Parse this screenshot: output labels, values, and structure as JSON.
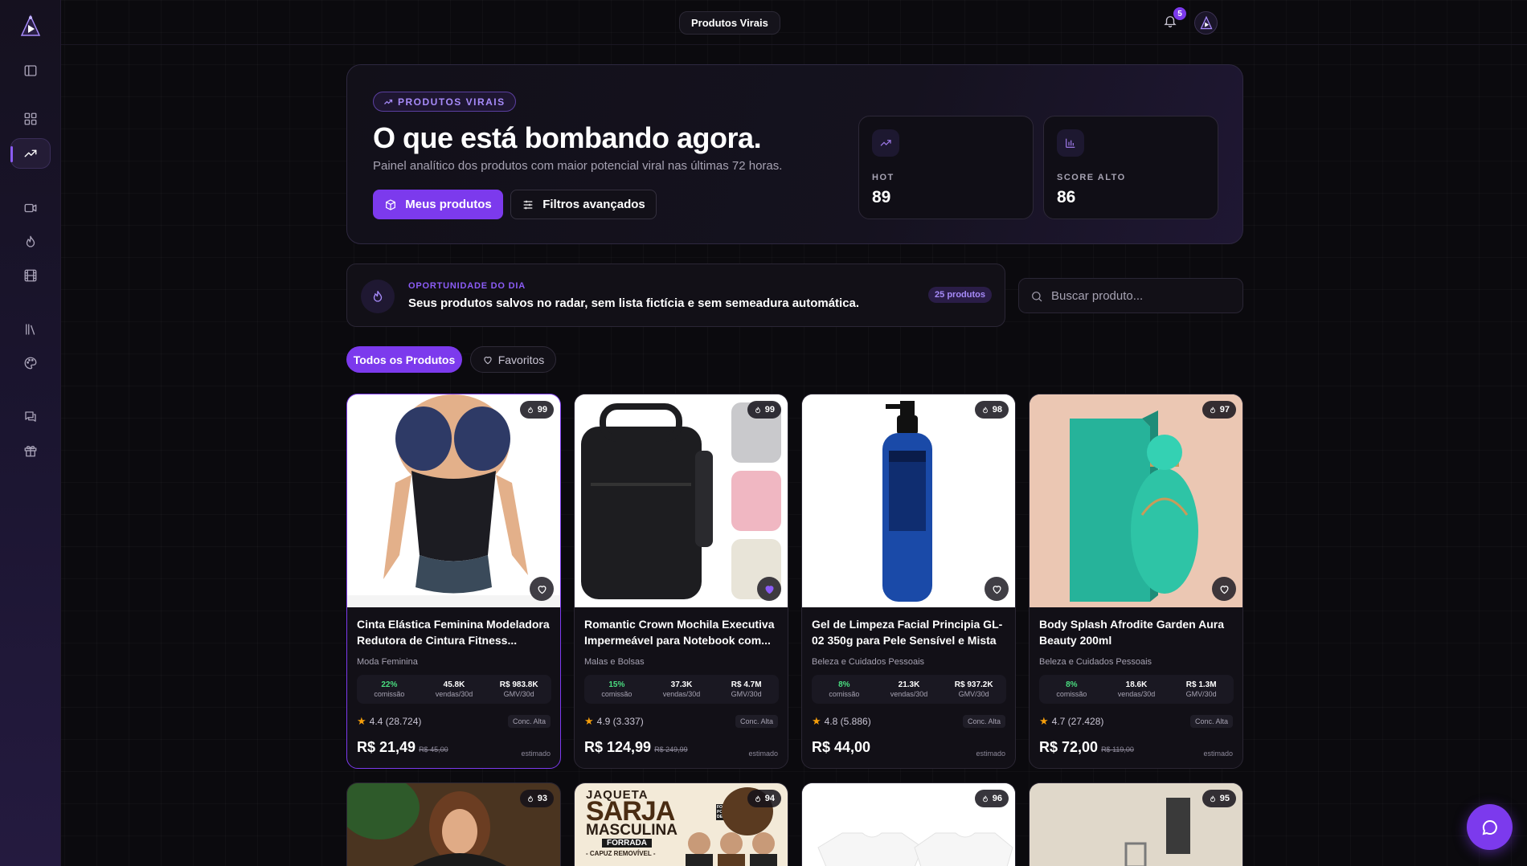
{
  "header": {
    "title": "Produtos Virais",
    "notifications": "5"
  },
  "hero": {
    "pill": "PRODUTOS VIRAIS",
    "title": "O que está bombando agora.",
    "subtitle": "Painel analítico dos produtos com maior potencial viral nas últimas 72 horas.",
    "primary_button": "Meus produtos",
    "secondary_button": "Filtros avançados",
    "stats": [
      {
        "label": "HOT",
        "value": "89",
        "icon": "trending-up-icon"
      },
      {
        "label": "SCORE ALTO",
        "value": "86",
        "icon": "bar-chart-icon"
      }
    ]
  },
  "opportunity": {
    "kicker": "OPORTUNIDADE DO DIA",
    "text": "Seus produtos salvos no radar, sem lista fictícia e sem semeadura automática.",
    "count": "25 produtos"
  },
  "search": {
    "placeholder": "Buscar produto..."
  },
  "filters": {
    "all": "Todos os Produtos",
    "favorites": "Favoritos"
  },
  "products": [
    {
      "score": "99",
      "name": "Cinta Elástica Feminina Modeladora Redutora de Cintura Fitness...",
      "category": "Moda Feminina",
      "commission": "22%",
      "commission_label": "comissão",
      "sales": "45.8K",
      "sales_label": "vendas/30d",
      "gmv": "R$ 983.8K",
      "gmv_label": "GMV/30d",
      "rating": "4.4 (28.724)",
      "conc": "Conc. Alta",
      "price": "R$ 21,49",
      "old_price": "R$ 45,00",
      "est": "estimado",
      "favorite": false
    },
    {
      "score": "99",
      "name": "Romantic Crown Mochila Executiva Impermeável para Notebook com...",
      "category": "Malas e Bolsas",
      "commission": "15%",
      "commission_label": "comissão",
      "sales": "37.3K",
      "sales_label": "vendas/30d",
      "gmv": "R$ 4.7M",
      "gmv_label": "GMV/30d",
      "rating": "4.9 (3.337)",
      "conc": "Conc. Alta",
      "price": "R$ 124,99",
      "old_price": "R$ 249,99",
      "est": "estimado",
      "favorite": true
    },
    {
      "score": "98",
      "name": "Gel de Limpeza Facial Principia GL-02 350g para Pele Sensível e Mista",
      "category": "Beleza e Cuidados Pessoais",
      "commission": "8%",
      "commission_label": "comissão",
      "sales": "21.3K",
      "sales_label": "vendas/30d",
      "gmv": "R$ 937.2K",
      "gmv_label": "GMV/30d",
      "rating": "4.8 (5.886)",
      "conc": "Conc. Alta",
      "price": "R$ 44,00",
      "old_price": "",
      "est": "estimado",
      "favorite": false
    },
    {
      "score": "97",
      "name": "Body Splash Afrodite Garden Aura Beauty 200ml",
      "category": "Beleza e Cuidados Pessoais",
      "commission": "8%",
      "commission_label": "comissão",
      "sales": "18.6K",
      "sales_label": "vendas/30d",
      "gmv": "R$ 1.3M",
      "gmv_label": "GMV/30d",
      "rating": "4.7 (27.428)",
      "conc": "Conc. Alta",
      "price": "R$ 72,00",
      "old_price": "R$ 119,00",
      "est": "estimado",
      "favorite": false
    }
  ],
  "products_row2": [
    {
      "score": "93"
    },
    {
      "score": "94",
      "image_text": [
        "JAQUETA",
        "SARJA",
        "MASCULINA",
        "FORRADA",
        "- CAPUZ REMOVÍVEL -",
        "FORRADA POR DENTRO"
      ]
    },
    {
      "score": "96"
    },
    {
      "score": "95"
    }
  ],
  "colors": {
    "accent": "#7c3aed",
    "accent_light": "#a78bfa",
    "success": "#4ade80",
    "star": "#f59e0b",
    "background": "#0b0a0e"
  }
}
